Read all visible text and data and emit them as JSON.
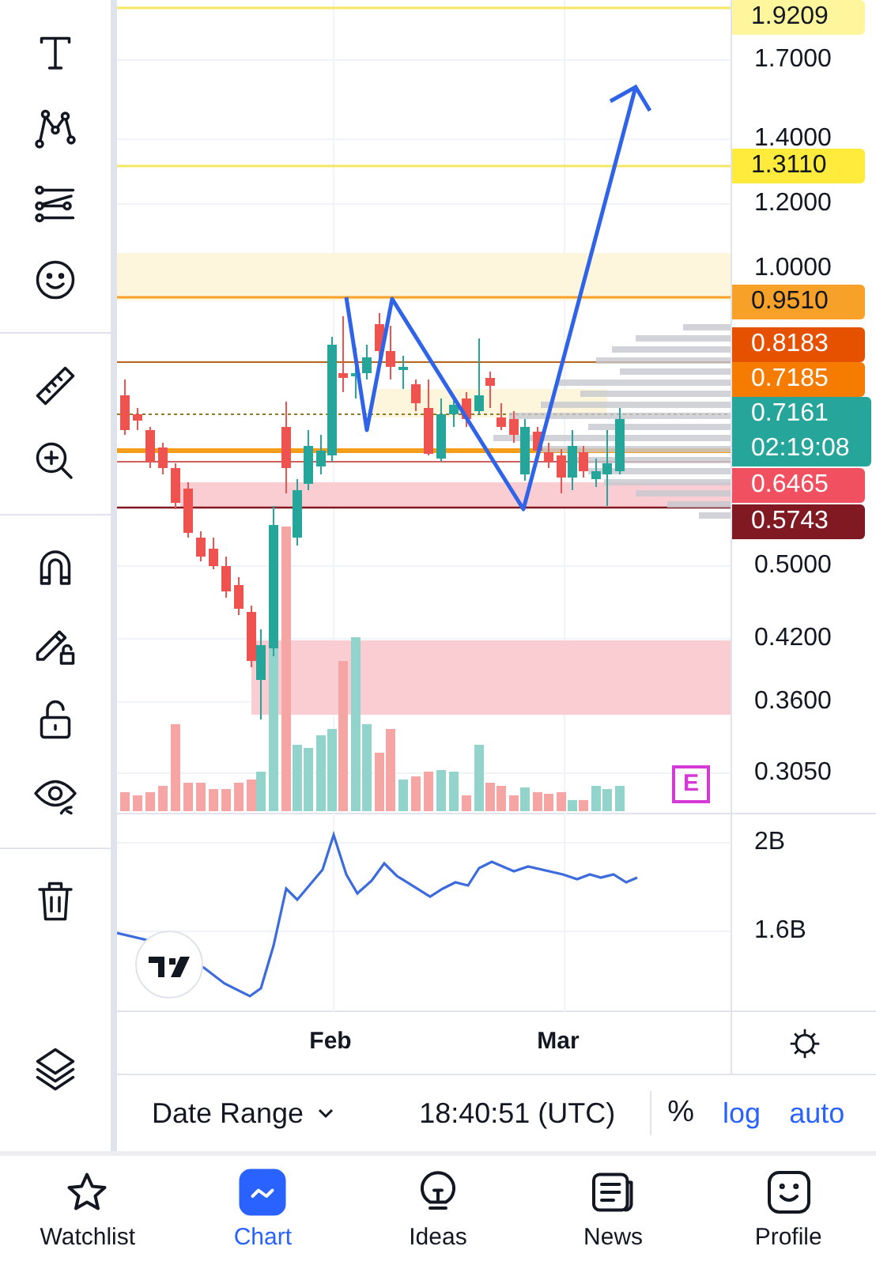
{
  "price_axis": {
    "labels": [
      {
        "text": "1.7000"
      },
      {
        "text": "1.4000"
      },
      {
        "text": "1.2000"
      },
      {
        "text": "1.0000"
      },
      {
        "text": "0.5000"
      },
      {
        "text": "0.4200"
      },
      {
        "text": "0.3600"
      },
      {
        "text": "0.3050"
      }
    ]
  },
  "price_tags": [
    {
      "text": "1.9209",
      "color": "#fff59d"
    },
    {
      "text": "1.3110",
      "color": "#ffeb3b"
    },
    {
      "text": "0.9510",
      "color": "#f7a128"
    },
    {
      "text": "0.8183",
      "color": "#e65100"
    },
    {
      "text": "0.7185",
      "color": "#f57c00"
    },
    {
      "text": "0.7161",
      "countdown": "02:19:08",
      "color": "#26a69a"
    },
    {
      "text": "0.6465",
      "color": "#f0505f"
    },
    {
      "text": "0.5743",
      "color": "#801922"
    }
  ],
  "earnings_marker": "E",
  "indicator_axis": [
    {
      "text": "2B"
    },
    {
      "text": "1.6B"
    }
  ],
  "time_axis": [
    {
      "text": "Feb"
    },
    {
      "text": "Mar"
    }
  ],
  "bottom_bar": {
    "date_range": "Date Range",
    "clock": "18:40:51 (UTC)",
    "percent": "%",
    "log": "log",
    "auto": "auto"
  },
  "nav": [
    {
      "label": "Watchlist",
      "selected": false
    },
    {
      "label": "Chart",
      "selected": true
    },
    {
      "label": "Ideas",
      "selected": false
    },
    {
      "label": "News",
      "selected": false
    },
    {
      "label": "Profile",
      "selected": false
    }
  ]
}
